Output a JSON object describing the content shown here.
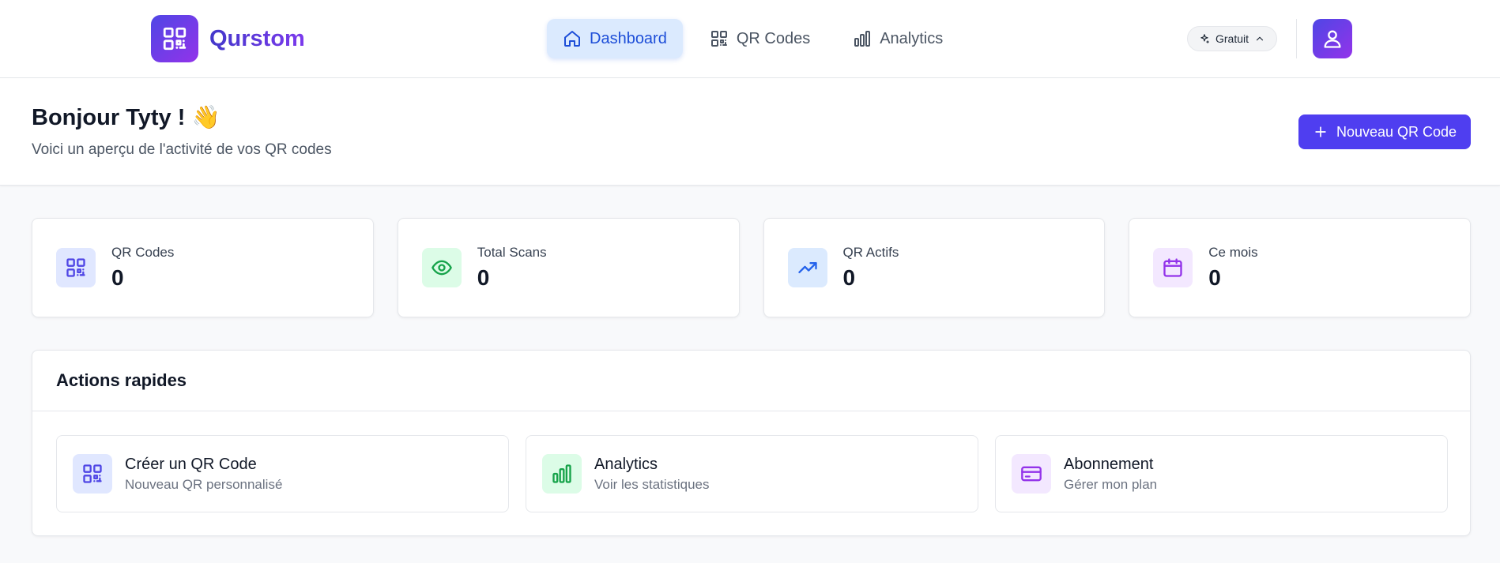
{
  "brand": {
    "name": "Qurstom"
  },
  "nav": {
    "items": [
      {
        "label": "Dashboard",
        "icon": "home-icon",
        "active": true
      },
      {
        "label": "QR Codes",
        "icon": "qr-icon",
        "active": false
      },
      {
        "label": "Analytics",
        "icon": "bar-chart-icon",
        "active": false
      }
    ]
  },
  "plan_badge": {
    "label": "Gratuit"
  },
  "header": {
    "greeting": "Bonjour Tyty ! 👋",
    "subtitle": "Voici un aperçu de l'activité de vos QR codes",
    "new_button_label": "Nouveau QR Code"
  },
  "stats": [
    {
      "label": "QR Codes",
      "value": "0",
      "icon": "qr-icon",
      "color": "#4f46e5",
      "bg": "#e0e7ff"
    },
    {
      "label": "Total Scans",
      "value": "0",
      "icon": "eye-icon",
      "color": "#16a34a",
      "bg": "#dcfce7"
    },
    {
      "label": "QR Actifs",
      "value": "0",
      "icon": "trending-up-icon",
      "color": "#2563eb",
      "bg": "#dbeafe"
    },
    {
      "label": "Ce mois",
      "value": "0",
      "icon": "calendar-icon",
      "color": "#9333ea",
      "bg": "#f3e8ff"
    }
  ],
  "quick_actions": {
    "title": "Actions rapides",
    "items": [
      {
        "title": "Créer un QR Code",
        "subtitle": "Nouveau QR personnalisé",
        "icon": "qr-icon",
        "color": "#4f46e5",
        "bg": "#e0e7ff"
      },
      {
        "title": "Analytics",
        "subtitle": "Voir les statistiques",
        "icon": "bar-chart-icon",
        "color": "#16a34a",
        "bg": "#dcfce7"
      },
      {
        "title": "Abonnement",
        "subtitle": "Gérer mon plan",
        "icon": "credit-card-icon",
        "color": "#9333ea",
        "bg": "#f3e8ff"
      }
    ]
  }
}
